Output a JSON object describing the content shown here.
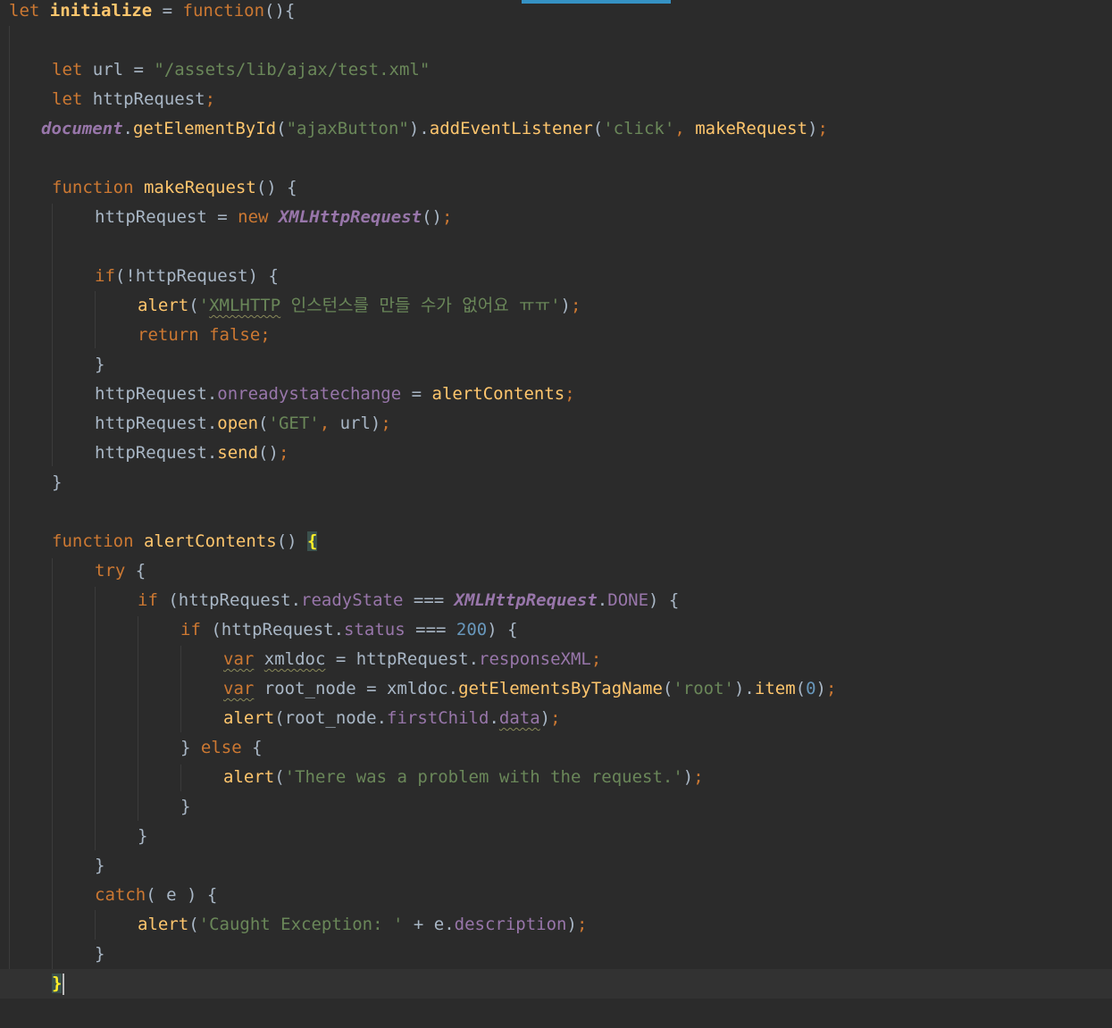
{
  "editor": {
    "language": "javascript",
    "colors": {
      "background": "#2b2b2b",
      "current_line": "#323232",
      "keyword": "#cc7832",
      "function_name": "#ffc66d",
      "string": "#6a8759",
      "number": "#6897bb",
      "property": "#9876aa",
      "identifier": "#a9b7c6",
      "scroll_thumb": "#3592c4"
    },
    "lines": [
      [
        [
          "kw",
          "let"
        ],
        [
          "id",
          " "
        ],
        [
          "def",
          "initialize"
        ],
        [
          "id",
          " = "
        ],
        [
          "kw",
          "function"
        ],
        [
          "id",
          "(){"
        ]
      ],
      [],
      [
        [
          "kw",
          "let"
        ],
        [
          "id",
          " url = "
        ],
        [
          "str",
          "\"/assets/lib/ajax/test.xml\""
        ]
      ],
      [
        [
          "kw",
          "let"
        ],
        [
          "id",
          " httpRequest"
        ],
        [
          "punct",
          ";"
        ]
      ],
      [
        [
          "glob",
          "document"
        ],
        [
          "id",
          "."
        ],
        [
          "fn",
          "getElementById"
        ],
        [
          "id",
          "("
        ],
        [
          "str",
          "\"ajaxButton\""
        ],
        [
          "id",
          ")."
        ],
        [
          "fn",
          "addEventListener"
        ],
        [
          "id",
          "("
        ],
        [
          "str",
          "'click'"
        ],
        [
          "punct",
          ","
        ],
        [
          "id",
          " "
        ],
        [
          "fn",
          "makeRequest"
        ],
        [
          "id",
          ")"
        ],
        [
          "punct",
          ";"
        ]
      ],
      [],
      [
        [
          "kw",
          "function"
        ],
        [
          "id",
          " "
        ],
        [
          "fn",
          "makeRequest"
        ],
        [
          "id",
          "() {"
        ]
      ],
      [
        [
          "id",
          "httpRequest = "
        ],
        [
          "kw",
          "new"
        ],
        [
          "id",
          " "
        ],
        [
          "cls",
          "XMLHttpRequest"
        ],
        [
          "id",
          "()"
        ],
        [
          "punct",
          ";"
        ]
      ],
      [],
      [
        [
          "kw",
          "if"
        ],
        [
          "id",
          "(!httpRequest) {"
        ]
      ],
      [
        [
          "fn",
          "alert"
        ],
        [
          "id",
          "("
        ],
        [
          "str",
          "'"
        ],
        [
          "strw",
          "XMLHTTP"
        ],
        [
          "str",
          " 인스턴스를 만들 수가 없어요 ㅠㅠ'"
        ],
        [
          "id",
          ")"
        ],
        [
          "punct",
          ";"
        ]
      ],
      [
        [
          "kw",
          "return false;"
        ]
      ],
      [
        [
          "id",
          "}"
        ]
      ],
      [
        [
          "id",
          "httpRequest."
        ],
        [
          "prop",
          "onreadystatechange"
        ],
        [
          "id",
          " = "
        ],
        [
          "fn",
          "alertContents"
        ],
        [
          "punct",
          ";"
        ]
      ],
      [
        [
          "id",
          "httpRequest."
        ],
        [
          "fn",
          "open"
        ],
        [
          "id",
          "("
        ],
        [
          "str",
          "'GET'"
        ],
        [
          "punct",
          ","
        ],
        [
          "id",
          " url)"
        ],
        [
          "punct",
          ";"
        ]
      ],
      [
        [
          "id",
          "httpRequest."
        ],
        [
          "fn",
          "send"
        ],
        [
          "id",
          "()"
        ],
        [
          "punct",
          ";"
        ]
      ],
      [
        [
          "id",
          "}"
        ]
      ],
      [],
      [
        [
          "kw",
          "function"
        ],
        [
          "id",
          " "
        ],
        [
          "fn",
          "alertContents"
        ],
        [
          "id",
          "() "
        ],
        [
          "bracehl",
          "{"
        ]
      ],
      [
        [
          "kw",
          "try"
        ],
        [
          "id",
          " {"
        ]
      ],
      [
        [
          "kw",
          "if"
        ],
        [
          "id",
          " (httpRequest."
        ],
        [
          "prop",
          "readyState"
        ],
        [
          "id",
          " === "
        ],
        [
          "cls",
          "XMLHttpRequest"
        ],
        [
          "id",
          "."
        ],
        [
          "prop",
          "DONE"
        ],
        [
          "id",
          ") {"
        ]
      ],
      [
        [
          "kw",
          "if"
        ],
        [
          "id",
          " (httpRequest."
        ],
        [
          "prop",
          "status"
        ],
        [
          "id",
          " === "
        ],
        [
          "num",
          "200"
        ],
        [
          "id",
          ") {"
        ]
      ],
      [
        [
          "kww",
          "var"
        ],
        [
          "id",
          " "
        ],
        [
          "idw",
          "xmldoc"
        ],
        [
          "id",
          " = httpRequest."
        ],
        [
          "prop",
          "responseXML"
        ],
        [
          "punct",
          ";"
        ]
      ],
      [
        [
          "kww",
          "var"
        ],
        [
          "id",
          " root_node = xmldoc."
        ],
        [
          "fn",
          "getElementsByTagName"
        ],
        [
          "id",
          "("
        ],
        [
          "str",
          "'root'"
        ],
        [
          "id",
          ")."
        ],
        [
          "fn",
          "item"
        ],
        [
          "id",
          "("
        ],
        [
          "num",
          "0"
        ],
        [
          "id",
          ")"
        ],
        [
          "punct",
          ";"
        ]
      ],
      [
        [
          "fn",
          "alert"
        ],
        [
          "id",
          "(root_node."
        ],
        [
          "prop",
          "firstChild"
        ],
        [
          "id",
          "."
        ],
        [
          "propw",
          "data"
        ],
        [
          "id",
          ")"
        ],
        [
          "punct",
          ";"
        ]
      ],
      [
        [
          "id",
          "} "
        ],
        [
          "kw",
          "else"
        ],
        [
          "id",
          " {"
        ]
      ],
      [
        [
          "fn",
          "alert"
        ],
        [
          "id",
          "("
        ],
        [
          "str",
          "'There was a problem with the request.'"
        ],
        [
          "id",
          ")"
        ],
        [
          "punct",
          ";"
        ]
      ],
      [
        [
          "id",
          "}"
        ]
      ],
      [
        [
          "id",
          "}"
        ]
      ],
      [
        [
          "id",
          "}"
        ]
      ],
      [
        [
          "kw",
          "catch"
        ],
        [
          "id",
          "( e ) {"
        ]
      ],
      [
        [
          "fn",
          "alert"
        ],
        [
          "id",
          "("
        ],
        [
          "str",
          "'Caught Exception: '"
        ],
        [
          "id",
          " + e."
        ],
        [
          "prop",
          "description"
        ],
        [
          "id",
          ")"
        ],
        [
          "punct",
          ";"
        ]
      ],
      [
        [
          "id",
          "}"
        ]
      ],
      [
        [
          "bracehl",
          "}"
        ],
        [
          "caret",
          ""
        ]
      ],
      []
    ]
  }
}
